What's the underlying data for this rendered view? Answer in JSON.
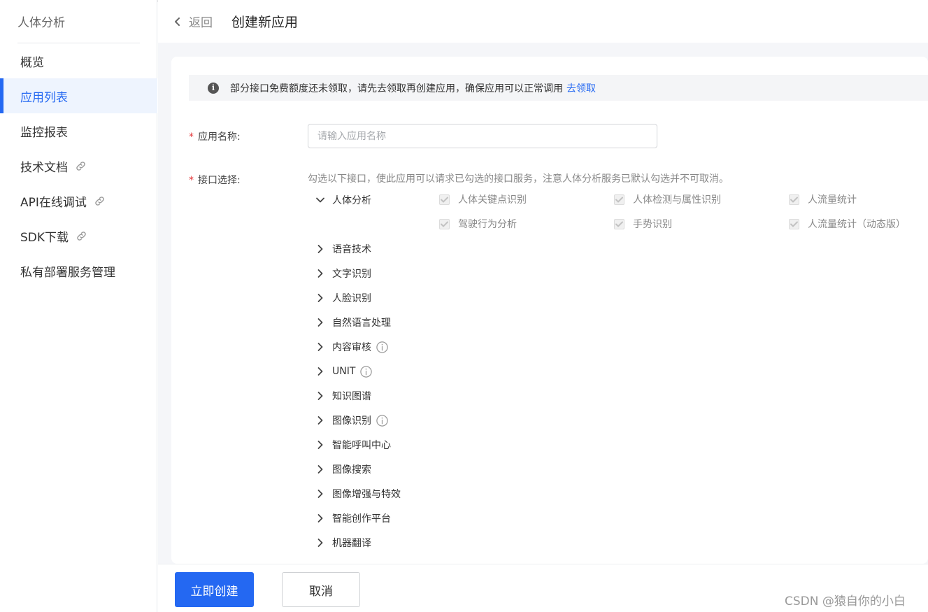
{
  "sidebar": {
    "title": "人体分析",
    "items": [
      {
        "label": "概览",
        "active": false,
        "external": false
      },
      {
        "label": "应用列表",
        "active": true,
        "external": false
      },
      {
        "label": "监控报表",
        "active": false,
        "external": false
      },
      {
        "label": "技术文档",
        "active": false,
        "external": true
      },
      {
        "label": "API在线调试",
        "active": false,
        "external": true
      },
      {
        "label": "SDK下载",
        "active": false,
        "external": true
      },
      {
        "label": "私有部署服务管理",
        "active": false,
        "external": false
      }
    ]
  },
  "header": {
    "back_label": "返回",
    "title": "创建新应用"
  },
  "notice": {
    "text": "部分接口免费额度还未领取，请先去领取再创建应用，确保应用可以正常调用",
    "link": "去领取"
  },
  "form": {
    "name_label": "应用名称:",
    "name_placeholder": "请输入应用名称",
    "api_label": "接口选择:",
    "api_hint": "勾选以下接口，使此应用可以请求已勾选的接口服务，注意人体分析服务已默认勾选并不可取消。",
    "expanded_group": {
      "label": "人体分析",
      "options": [
        {
          "label": "人体关键点识别",
          "checked": true,
          "disabled": true
        },
        {
          "label": "人体检测与属性识别",
          "checked": true,
          "disabled": true
        },
        {
          "label": "人流量统计",
          "checked": true,
          "disabled": true
        },
        {
          "label": "驾驶行为分析",
          "checked": true,
          "disabled": true
        },
        {
          "label": "手势识别",
          "checked": true,
          "disabled": true
        },
        {
          "label": "人流量统计（动态版）",
          "checked": true,
          "disabled": true
        }
      ]
    },
    "collapsed_groups": [
      {
        "label": "语音技术",
        "info": false
      },
      {
        "label": "文字识别",
        "info": false
      },
      {
        "label": "人脸识别",
        "info": false
      },
      {
        "label": "自然语言处理",
        "info": false
      },
      {
        "label": "内容审核",
        "info": true
      },
      {
        "label": "UNIT",
        "info": true
      },
      {
        "label": "知识图谱",
        "info": false
      },
      {
        "label": "图像识别",
        "info": true
      },
      {
        "label": "智能呼叫中心",
        "info": false
      },
      {
        "label": "图像搜索",
        "info": false
      },
      {
        "label": "图像增强与特效",
        "info": false
      },
      {
        "label": "智能创作平台",
        "info": false
      },
      {
        "label": "机器翻译",
        "info": false
      }
    ]
  },
  "footer": {
    "create_label": "立即创建",
    "cancel_label": "取消"
  },
  "watermark": "CSDN @猿自你的小白",
  "colors": {
    "primary": "#2468f2",
    "required": "#e4393c",
    "active_bg": "#eef4fe"
  }
}
